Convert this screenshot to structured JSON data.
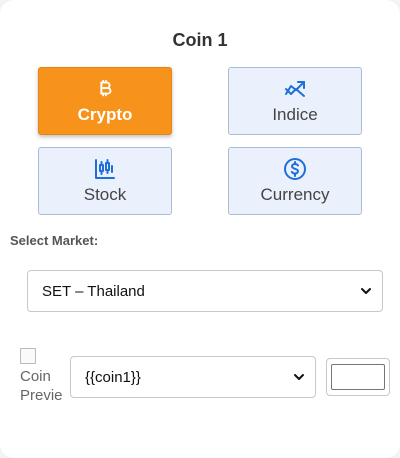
{
  "title": "Coin 1",
  "asset_types": [
    {
      "label": "Crypto",
      "icon": "bitcoin-icon",
      "selected": true
    },
    {
      "label": "Indice",
      "icon": "trending-up-icon",
      "selected": false
    },
    {
      "label": "Stock",
      "icon": "candlestick-chart-icon",
      "selected": false
    },
    {
      "label": "Currency",
      "icon": "dollar-circle-icon",
      "selected": false
    }
  ],
  "market": {
    "label": "Select Market:",
    "selected": "SET – Thailand"
  },
  "coin_row": {
    "preview_alt": "Coin Preview",
    "coin_selected": "{{coin1}}",
    "amount": ""
  },
  "colors": {
    "accent": "#f7931a",
    "tile_bg": "#eaf1fc",
    "icon_blue": "#1e6fd9"
  }
}
